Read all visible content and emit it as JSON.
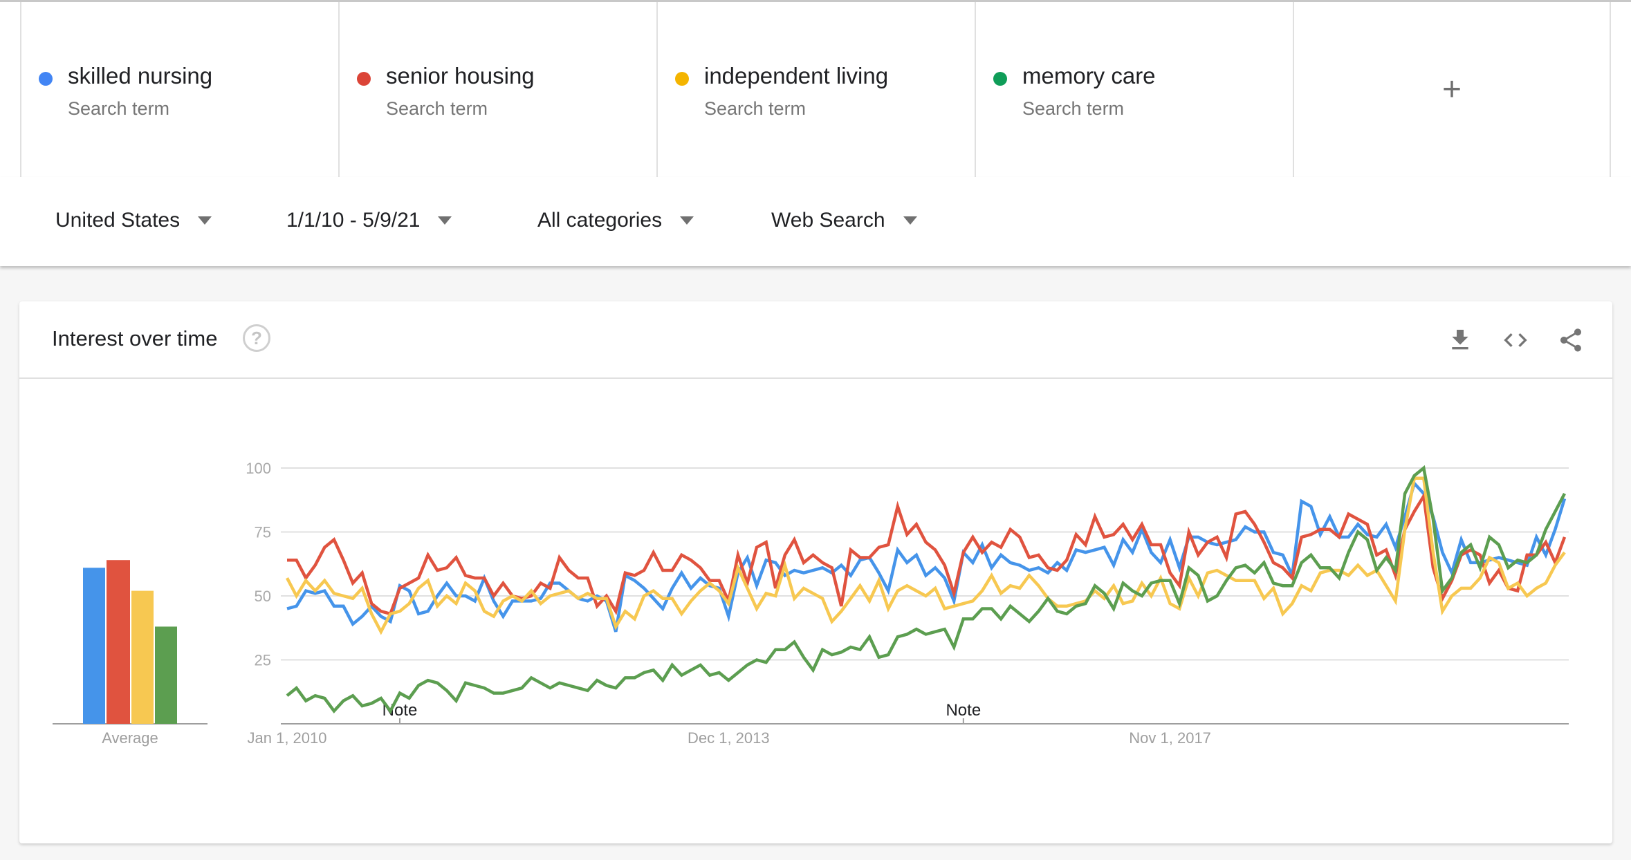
{
  "terms": [
    {
      "name": "skilled nursing",
      "sub": "Search term",
      "color": "#4285f4"
    },
    {
      "name": "senior housing",
      "sub": "Search term",
      "color": "#db4437"
    },
    {
      "name": "independent living",
      "sub": "Search term",
      "color": "#f4b400"
    },
    {
      "name": "memory care",
      "sub": "Search term",
      "color": "#0f9d58"
    }
  ],
  "add_term": {
    "label": "+",
    "icon": "plus-icon"
  },
  "filters": {
    "region": "United States",
    "date_range": "1/1/10 - 5/9/21",
    "category": "All categories",
    "search_type": "Web Search"
  },
  "card": {
    "title": "Interest over time",
    "help_icon": "?",
    "actions": [
      "download-icon",
      "embed-code-icon",
      "share-icon"
    ]
  },
  "chart_data": [
    {
      "type": "bar",
      "title": "Average",
      "categories": [
        "skilled nursing",
        "senior housing",
        "independent living",
        "memory care"
      ],
      "values": [
        61,
        64,
        52,
        38
      ],
      "colors": [
        "#4594ea",
        "#e0533f",
        "#f7c851",
        "#5c9e50"
      ],
      "xlabel": "Average",
      "ylim": [
        0,
        100
      ]
    },
    {
      "type": "line",
      "title": "Interest over time",
      "x_start": "2010-01",
      "x_interval": "month",
      "x_count": 137,
      "ylim": [
        0,
        100
      ],
      "yticks": [
        25,
        50,
        75,
        100
      ],
      "ytick_labels": [
        "25",
        "50",
        "75",
        "100"
      ],
      "xtick_labels": [
        {
          "label": "Jan 1, 2010",
          "index": 0
        },
        {
          "label": "Dec 1, 2013",
          "index": 47
        },
        {
          "label": "Nov 1, 2017",
          "index": 94
        }
      ],
      "annotations": [
        {
          "label": "Note",
          "index": 12
        },
        {
          "label": "Note",
          "index": 72
        }
      ],
      "grid": true,
      "series": [
        {
          "name": "skilled nursing",
          "color": "#4594ea",
          "values": [
            45,
            46,
            52,
            51,
            52,
            46,
            46,
            39,
            42,
            46,
            42,
            40,
            54,
            52,
            43,
            44,
            50,
            55,
            50,
            50,
            48,
            57,
            48,
            42,
            48,
            48,
            48,
            49,
            55,
            55,
            52,
            49,
            48,
            50,
            48,
            36,
            58,
            56,
            53,
            49,
            45,
            53,
            59,
            53,
            57,
            54,
            53,
            42,
            59,
            65,
            54,
            64,
            63,
            58,
            60,
            59,
            60,
            61,
            59,
            62,
            58,
            64,
            65,
            59,
            52,
            68,
            63,
            66,
            58,
            61,
            57,
            48,
            67,
            63,
            70,
            61,
            66,
            63,
            62,
            60,
            61,
            59,
            63,
            60,
            68,
            67,
            68,
            69,
            62,
            72,
            67,
            76,
            67,
            63,
            72,
            61,
            73,
            73,
            71,
            70,
            71,
            72,
            77,
            75,
            75,
            67,
            66,
            58,
            87,
            85,
            74,
            81,
            73,
            73,
            78,
            74,
            73,
            78,
            69,
            81,
            94,
            90,
            81,
            67,
            59,
            72,
            63,
            63,
            64,
            65,
            64,
            63,
            62,
            73,
            66,
            76,
            88
          ]
        },
        {
          "name": "senior housing",
          "color": "#e0533f",
          "values": [
            64,
            64,
            57,
            62,
            69,
            72,
            64,
            55,
            59,
            47,
            44,
            43,
            53,
            55,
            57,
            66,
            60,
            61,
            65,
            58,
            57,
            57,
            50,
            55,
            50,
            49,
            50,
            55,
            53,
            65,
            60,
            57,
            57,
            46,
            50,
            44,
            59,
            58,
            60,
            67,
            60,
            60,
            66,
            64,
            61,
            56,
            56,
            48,
            66,
            55,
            69,
            71,
            53,
            66,
            72,
            63,
            66,
            63,
            61,
            46,
            68,
            65,
            65,
            69,
            70,
            85,
            74,
            78,
            71,
            68,
            62,
            51,
            67,
            73,
            67,
            71,
            69,
            76,
            73,
            65,
            66,
            61,
            60,
            64,
            74,
            70,
            81,
            73,
            74,
            78,
            72,
            78,
            70,
            70,
            59,
            54,
            75,
            66,
            71,
            73,
            65,
            82,
            83,
            78,
            71,
            63,
            61,
            57,
            73,
            74,
            76,
            76,
            73,
            82,
            80,
            78,
            66,
            68,
            58,
            76,
            83,
            89,
            61,
            49,
            56,
            66,
            68,
            66,
            55,
            60,
            53,
            52,
            66,
            66,
            71,
            63,
            73
          ]
        },
        {
          "name": "independent living",
          "color": "#f7c851",
          "values": [
            57,
            50,
            56,
            52,
            56,
            51,
            50,
            49,
            53,
            43,
            36,
            43,
            44,
            47,
            53,
            56,
            46,
            50,
            47,
            55,
            52,
            44,
            42,
            48,
            50,
            48,
            52,
            47,
            50,
            51,
            52,
            49,
            51,
            49,
            49,
            38,
            44,
            41,
            50,
            52,
            49,
            49,
            43,
            48,
            52,
            55,
            52,
            47,
            61,
            53,
            45,
            51,
            50,
            62,
            49,
            53,
            51,
            49,
            40,
            44,
            49,
            54,
            48,
            56,
            45,
            52,
            54,
            52,
            50,
            53,
            45,
            46,
            47,
            48,
            52,
            58,
            51,
            54,
            53,
            58,
            54,
            49,
            46,
            46,
            47,
            48,
            52,
            49,
            54,
            47,
            48,
            55,
            50,
            57,
            47,
            45,
            57,
            50,
            59,
            60,
            58,
            56,
            56,
            56,
            49,
            53,
            43,
            47,
            54,
            52,
            59,
            60,
            60,
            58,
            62,
            58,
            60,
            54,
            48,
            76,
            96,
            96,
            67,
            44,
            50,
            53,
            53,
            57,
            65,
            63,
            53,
            55,
            50,
            53,
            55,
            62,
            67
          ]
        },
        {
          "name": "memory care",
          "color": "#5c9e50",
          "values": [
            11,
            14,
            9,
            11,
            10,
            5,
            9,
            11,
            7,
            8,
            10,
            5,
            12,
            10,
            15,
            17,
            16,
            13,
            9,
            16,
            15,
            14,
            12,
            12,
            13,
            14,
            18,
            16,
            14,
            16,
            15,
            14,
            13,
            17,
            15,
            14,
            18,
            18,
            20,
            21,
            17,
            23,
            19,
            21,
            23,
            19,
            20,
            17,
            20,
            23,
            25,
            24,
            29,
            29,
            32,
            26,
            21,
            29,
            27,
            28,
            30,
            29,
            34,
            26,
            27,
            34,
            35,
            37,
            35,
            36,
            37,
            30,
            41,
            41,
            45,
            45,
            41,
            46,
            43,
            40,
            44,
            49,
            44,
            43,
            46,
            47,
            54,
            51,
            45,
            55,
            52,
            50,
            55,
            56,
            56,
            47,
            61,
            58,
            48,
            50,
            56,
            61,
            62,
            59,
            63,
            55,
            54,
            54,
            63,
            66,
            61,
            61,
            57,
            67,
            75,
            72,
            60,
            65,
            60,
            90,
            97,
            100,
            80,
            52,
            57,
            67,
            70,
            61,
            73,
            70,
            61,
            64,
            63,
            66,
            76,
            83,
            90
          ]
        }
      ]
    }
  ]
}
